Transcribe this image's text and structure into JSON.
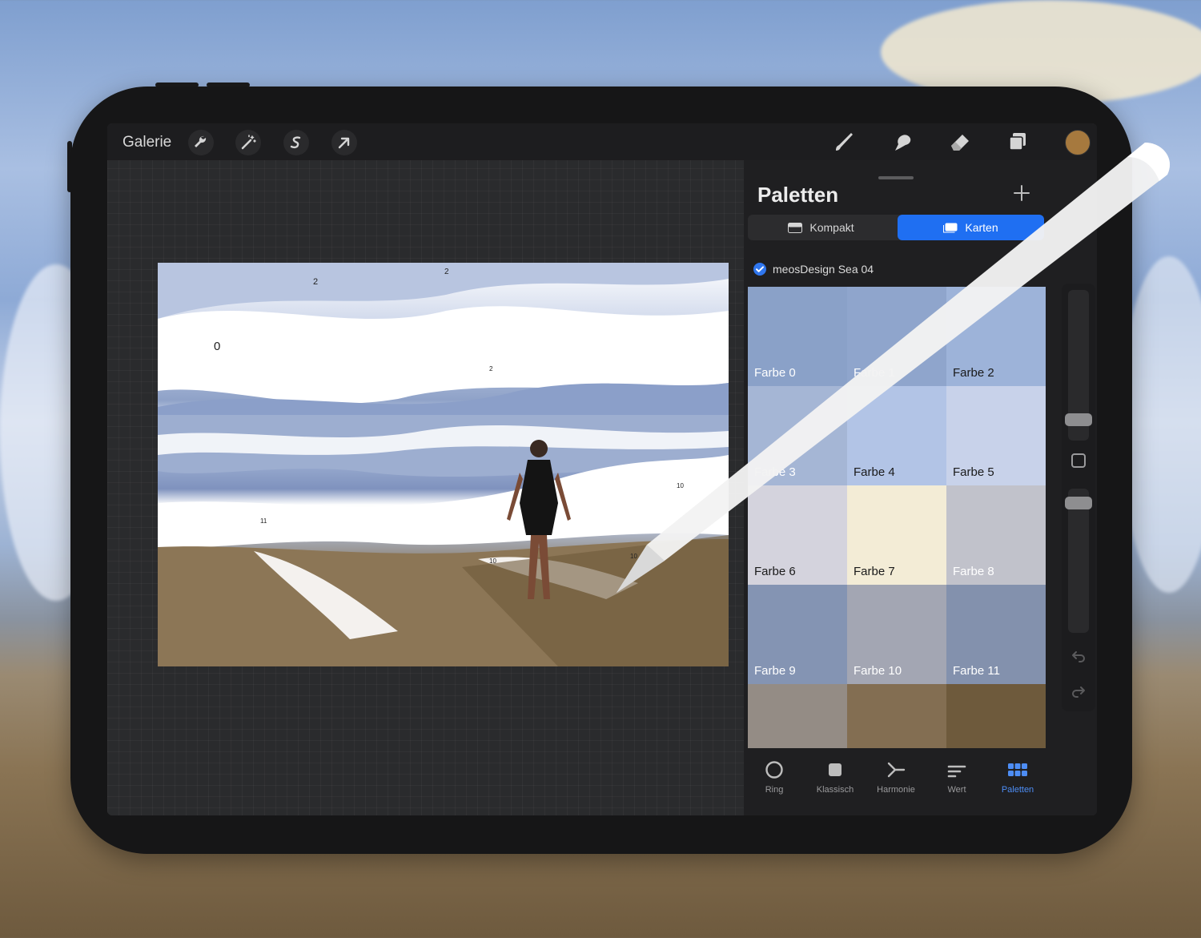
{
  "topbar": {
    "gallery_label": "Galerie",
    "left_tools": [
      "wrench-icon",
      "magic-wand-icon",
      "selection-s-icon",
      "transform-arrow-icon"
    ],
    "right_tools": [
      "brush-icon",
      "smudge-icon",
      "eraser-icon",
      "layers-icon"
    ],
    "active_color": "#a6793e"
  },
  "canvas": {
    "labels": [
      "0",
      "2",
      "2",
      "2",
      "10",
      "11",
      "10",
      "10"
    ]
  },
  "panel": {
    "title": "Paletten",
    "view_modes": {
      "compact": "Kompakt",
      "cards": "Karten",
      "active": "Karten"
    },
    "palette_name": "meosDesign Sea 04",
    "swatches": [
      {
        "label": "Farbe 0",
        "color": "#8aa1c8",
        "dark": false
      },
      {
        "label": "Farbe 1",
        "color": "#8fa5cc",
        "dark": false
      },
      {
        "label": "Farbe 2",
        "color": "#9db3d9",
        "dark": true
      },
      {
        "label": "Farbe 3",
        "color": "#a5b6d5",
        "dark": false
      },
      {
        "label": "Farbe 4",
        "color": "#b2c4e6",
        "dark": true
      },
      {
        "label": "Farbe 5",
        "color": "#c8d2ea",
        "dark": true
      },
      {
        "label": "Farbe 6",
        "color": "#d4d3dd",
        "dark": true
      },
      {
        "label": "Farbe 7",
        "color": "#f3ecd6",
        "dark": true
      },
      {
        "label": "Farbe 8",
        "color": "#c1c2cb",
        "dark": false
      },
      {
        "label": "Farbe 9",
        "color": "#8494b3",
        "dark": false
      },
      {
        "label": "Farbe 10",
        "color": "#a3a6b3",
        "dark": false
      },
      {
        "label": "Farbe 11",
        "color": "#8391ad",
        "dark": false
      },
      {
        "label": "",
        "color": "#948c85",
        "dark": false
      },
      {
        "label": "",
        "color": "#836e52",
        "dark": false
      },
      {
        "label": "",
        "color": "#6e5a3c",
        "dark": false
      }
    ],
    "bottom_tabs": [
      {
        "label": "Ring",
        "icon": "ring-icon"
      },
      {
        "label": "Klassisch",
        "icon": "square-icon"
      },
      {
        "label": "Harmonie",
        "icon": "harmony-icon"
      },
      {
        "label": "Wert",
        "icon": "sliders-icon"
      },
      {
        "label": "Paletten",
        "icon": "palette-grid-icon",
        "active": true
      }
    ]
  }
}
